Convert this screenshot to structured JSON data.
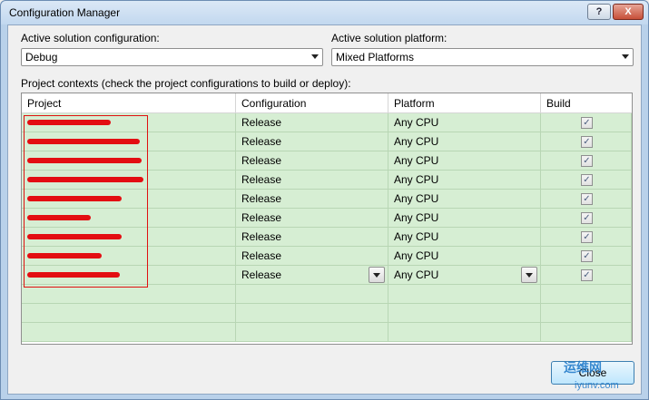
{
  "window": {
    "title": "Configuration Manager",
    "help_label": "?",
    "close_label": "X"
  },
  "solution_config": {
    "label": "Active solution configuration:",
    "value": "Debug"
  },
  "solution_platform": {
    "label": "Active solution platform:",
    "value": "Mixed Platforms"
  },
  "project_contexts_label": "Project contexts (check the project configurations to build or deploy):",
  "grid": {
    "columns": [
      "Project",
      "Configuration",
      "Platform",
      "Build"
    ],
    "rows": [
      {
        "configuration": "Release",
        "platform": "Any CPU",
        "build": true
      },
      {
        "configuration": "Release",
        "platform": "Any CPU",
        "build": true
      },
      {
        "configuration": "Release",
        "platform": "Any CPU",
        "build": true
      },
      {
        "configuration": "Release",
        "platform": "Any CPU",
        "build": true
      },
      {
        "configuration": "Release",
        "platform": "Any CPU",
        "build": true
      },
      {
        "configuration": "Release",
        "platform": "Any CPU",
        "build": true
      },
      {
        "configuration": "Release",
        "platform": "Any CPU",
        "build": true
      },
      {
        "configuration": "Release",
        "platform": "Any CPU",
        "build": true
      },
      {
        "configuration": "Release",
        "platform": "Any CPU",
        "build": true
      }
    ]
  },
  "close_button_label": "Close",
  "watermark": {
    "line1": "运维网",
    "line2": "iyunv.com"
  },
  "colors": {
    "row_bg": "#d6eed3",
    "redaction": "#e30e12",
    "title_bar": "#c2d8ef"
  }
}
